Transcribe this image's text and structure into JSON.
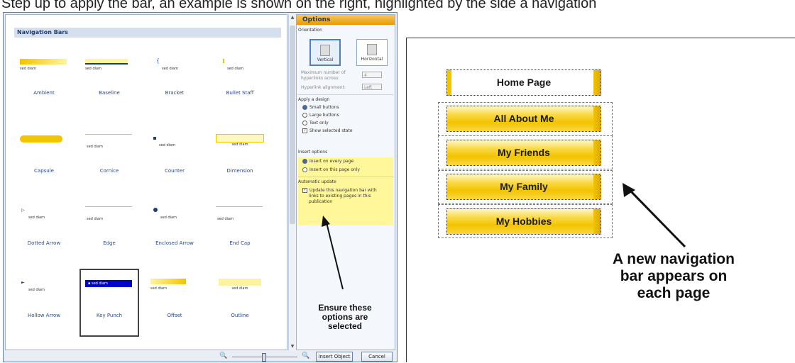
{
  "heading": "Step up to apply the bar, an example is shown on the right, highlighted by the side a navigation",
  "dialog": {
    "gallery_title": "Navigation Bars",
    "tiles": [
      {
        "label": "Ambient",
        "style": "ambient"
      },
      {
        "label": "Baseline",
        "style": "baseline"
      },
      {
        "label": "Bracket",
        "style": "bracket"
      },
      {
        "label": "Bullet Staff",
        "style": "bulletstaff"
      },
      {
        "label": "Capsule",
        "style": "capsule"
      },
      {
        "label": "Cornice",
        "style": "cornice"
      },
      {
        "label": "Counter",
        "style": "counter"
      },
      {
        "label": "Dimension",
        "style": "dimension"
      },
      {
        "label": "Dotted Arrow",
        "style": "dottedarrow"
      },
      {
        "label": "Edge",
        "style": "edge"
      },
      {
        "label": "Enclosed Arrow",
        "style": "enclosedarrow"
      },
      {
        "label": "End Cap",
        "style": "endcap"
      },
      {
        "label": "Hollow Arrow",
        "style": "hollowarrow"
      },
      {
        "label": "Key Punch",
        "style": "keypunch",
        "selected": true
      },
      {
        "label": "Offset",
        "style": "offset"
      },
      {
        "label": "Outline",
        "style": "outline"
      }
    ],
    "thumb_text": "sed diam",
    "options": {
      "title": "Options",
      "orientation_label": "Orientation",
      "vertical": "Vertical",
      "horizontal": "Horizontal",
      "max_links_label_1": "Maximum number of",
      "max_links_label_2": "hyperlinks across:",
      "max_links_value": "4",
      "alignment_label": "Hyperlink alignment:",
      "alignment_value": "Left",
      "apply_design": "Apply a design",
      "small_buttons": "Small buttons",
      "large_buttons": "Large buttons",
      "text_only": "Text only",
      "show_selected": "Show selected state",
      "insert_options": "Insert options",
      "insert_every": "Insert on every page",
      "insert_this": "Insert on this page only",
      "auto_update": "Automatic update",
      "update_1": "Update this navigation bar with",
      "update_2": "links to existing pages in this",
      "update_3": "publication"
    },
    "annotation_1": "Ensure these",
    "annotation_2": "options are",
    "annotation_3": "selected",
    "insert_button": "Insert Object",
    "cancel_button": "Cancel"
  },
  "preview": {
    "nav_items": [
      "Home Page",
      "All About Me",
      "My Friends",
      "My Family",
      "My Hobbies"
    ],
    "caption_1": "A new navigation",
    "caption_2": "bar appears on",
    "caption_3": "each page"
  },
  "colors": {
    "accent_gold": "#f3c400",
    "dialog_blue": "#1e3f74",
    "highlight_yellow": "#fff79a",
    "selected_blue": "#0000cc"
  }
}
